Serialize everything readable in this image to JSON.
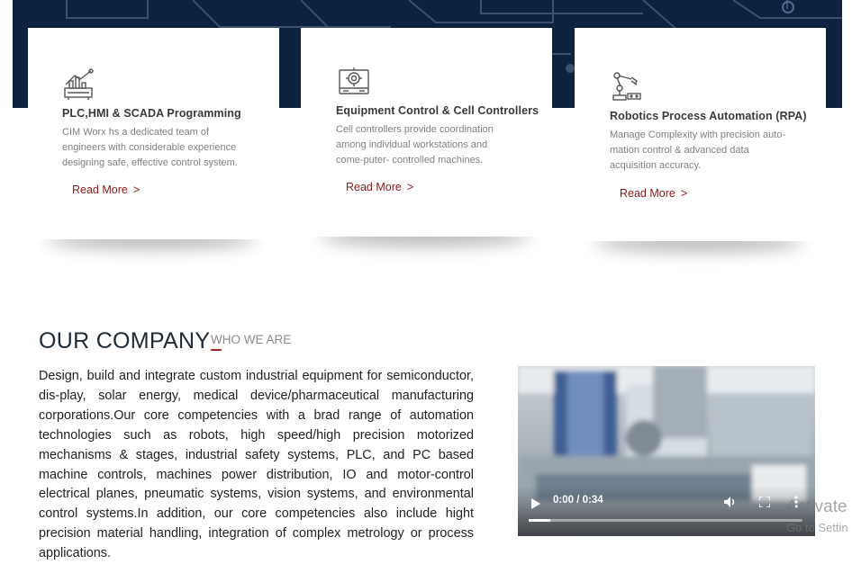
{
  "services": [
    {
      "icon": "plc-control-icon",
      "title": "PLC,HMI & SCADA Programming",
      "desc_lines": [
        "CIM Worx hs a dedicated team of",
        "engineers with considerable experience",
        "designing safe, effective control system."
      ],
      "link": "Read More"
    },
    {
      "icon": "cell-controller-icon",
      "title": "Equipment Control & Cell Controllers",
      "desc_lines": [
        "Cell controllers provide coordination",
        "among individual workstations and",
        "come-puter- controlled machines."
      ],
      "link": "Read More"
    },
    {
      "icon": "robot-arm-icon",
      "title": "Robotics Process Automation (RPA)",
      "desc_lines": [
        "Manage Complexity with precision auto-",
        "mation control & advanced data",
        "acquisition accuracy."
      ],
      "link": "Read More"
    }
  ],
  "read_more_chevron": ">",
  "company": {
    "heading": "OUR COMPANY",
    "subheading": "WHO WE ARE",
    "body": "Design, build and integrate custom industrial equipment for semiconductor, dis-play, solar energy, medical device/pharmaceutical manufacturing corporations.Our core competencies with a brad range of automation technologies such as robots, high speed/high precision motorized mechanisms & stages, industrial safety systems, PLC, and PC based machine controls, machines power distribution, IO and motor-control electrical planes, pneumatic systems, vision systems, and environmental control systems.In addition, our core competencies also include hight precision material handling, integration of complex metrology or process applications."
  },
  "video": {
    "time": "0:00 / 0:34",
    "progress": 0.08
  },
  "watermark": {
    "title": "Activate",
    "subtitle": "Go to Settin"
  },
  "colors": {
    "hero_band": "#0c2240",
    "link": "#8b1a1a",
    "accent": "#b22222"
  }
}
